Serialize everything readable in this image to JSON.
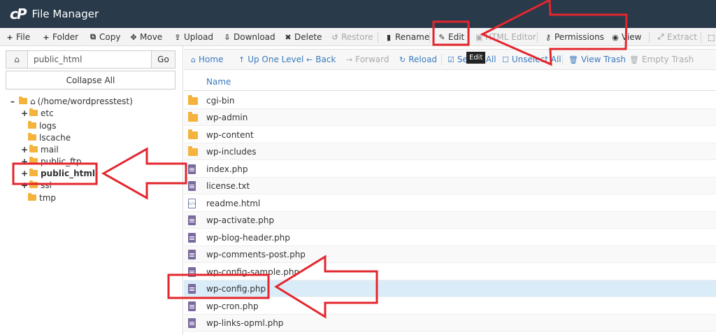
{
  "app": {
    "title": "File Manager",
    "logo_text": "cP"
  },
  "toolbar": {
    "buttons": [
      {
        "label": "File",
        "icon": "plus-icon",
        "glyph": "+"
      },
      {
        "label": "Folder",
        "icon": "plus-icon",
        "glyph": "+"
      },
      {
        "label": "Copy",
        "icon": "copy-icon",
        "glyph": "⧉"
      },
      {
        "label": "Move",
        "icon": "move-icon",
        "glyph": "✥"
      },
      {
        "label": "Upload",
        "icon": "upload-icon",
        "glyph": "⇪"
      },
      {
        "label": "Download",
        "icon": "download-icon",
        "glyph": "⇩"
      },
      {
        "label": "Delete",
        "icon": "delete-icon",
        "glyph": "✖"
      },
      {
        "label": "Restore",
        "icon": "restore-icon",
        "glyph": "↺"
      },
      {
        "label": "Rename",
        "icon": "rename-icon",
        "glyph": "▮"
      },
      {
        "label": "Edit",
        "icon": "pencil-icon",
        "glyph": "✎"
      },
      {
        "label": "HTML Editor",
        "icon": "html-editor-icon",
        "glyph": "▣"
      },
      {
        "label": "Permissions",
        "icon": "key-icon",
        "glyph": "⚷"
      },
      {
        "label": "View",
        "icon": "eye-icon",
        "glyph": "◉"
      },
      {
        "label": "Extract",
        "icon": "extract-icon",
        "glyph": "⤢"
      }
    ],
    "tooltip": "Edit"
  },
  "left_panel": {
    "path_value": "public_html",
    "go_label": "Go",
    "collapse_label": "Collapse All",
    "tree": [
      {
        "label": "(/home/wordpresstest)",
        "toggle": "–",
        "kind": "home"
      },
      {
        "label": "etc",
        "toggle": "+",
        "kind": "folder"
      },
      {
        "label": "logs",
        "toggle": "",
        "kind": "folder"
      },
      {
        "label": "lscache",
        "toggle": "",
        "kind": "folder"
      },
      {
        "label": "mail",
        "toggle": "+",
        "kind": "folder"
      },
      {
        "label": "public_ftp",
        "toggle": "+",
        "kind": "folder"
      },
      {
        "label": "public_html",
        "toggle": "+",
        "kind": "folder"
      },
      {
        "label": "ssl",
        "toggle": "+",
        "kind": "folder"
      },
      {
        "label": "tmp",
        "toggle": "",
        "kind": "folder"
      }
    ]
  },
  "nav_bar": {
    "buttons": [
      {
        "label": "Home",
        "glyph": "⌂"
      },
      {
        "label": "Up One Level",
        "glyph": "↑"
      },
      {
        "label": "Back",
        "glyph": "←"
      },
      {
        "label": "Forward",
        "glyph": "→"
      },
      {
        "label": "Reload",
        "glyph": "↻"
      },
      {
        "label": "Select All",
        "glyph": "☑"
      },
      {
        "label": "Unselect All",
        "glyph": "☐"
      },
      {
        "label": "View Trash",
        "glyph": "🗑"
      },
      {
        "label": "Empty Trash",
        "glyph": "🗑"
      }
    ]
  },
  "file_list": {
    "column_name": "Name",
    "rows": [
      {
        "name": "cgi-bin",
        "type": "folder"
      },
      {
        "name": "wp-admin",
        "type": "folder"
      },
      {
        "name": "wp-content",
        "type": "folder"
      },
      {
        "name": "wp-includes",
        "type": "folder"
      },
      {
        "name": "index.php",
        "type": "php"
      },
      {
        "name": "license.txt",
        "type": "txt"
      },
      {
        "name": "readme.html",
        "type": "html"
      },
      {
        "name": "wp-activate.php",
        "type": "php"
      },
      {
        "name": "wp-blog-header.php",
        "type": "php"
      },
      {
        "name": "wp-comments-post.php",
        "type": "php"
      },
      {
        "name": "wp-config-sample.php",
        "type": "php"
      },
      {
        "name": "wp-config.php",
        "type": "php"
      },
      {
        "name": "wp-cron.php",
        "type": "php"
      },
      {
        "name": "wp-links-opml.php",
        "type": "php"
      }
    ],
    "selected_file": "wp-config.php"
  },
  "colors": {
    "header_bg": "#293a4a",
    "link_blue": "#3a7bbf",
    "folder": "#f4b33d",
    "file_purple": "#7a6a9f",
    "selected_row": "#d9ecf8",
    "annotation_red": "#e3262d"
  }
}
